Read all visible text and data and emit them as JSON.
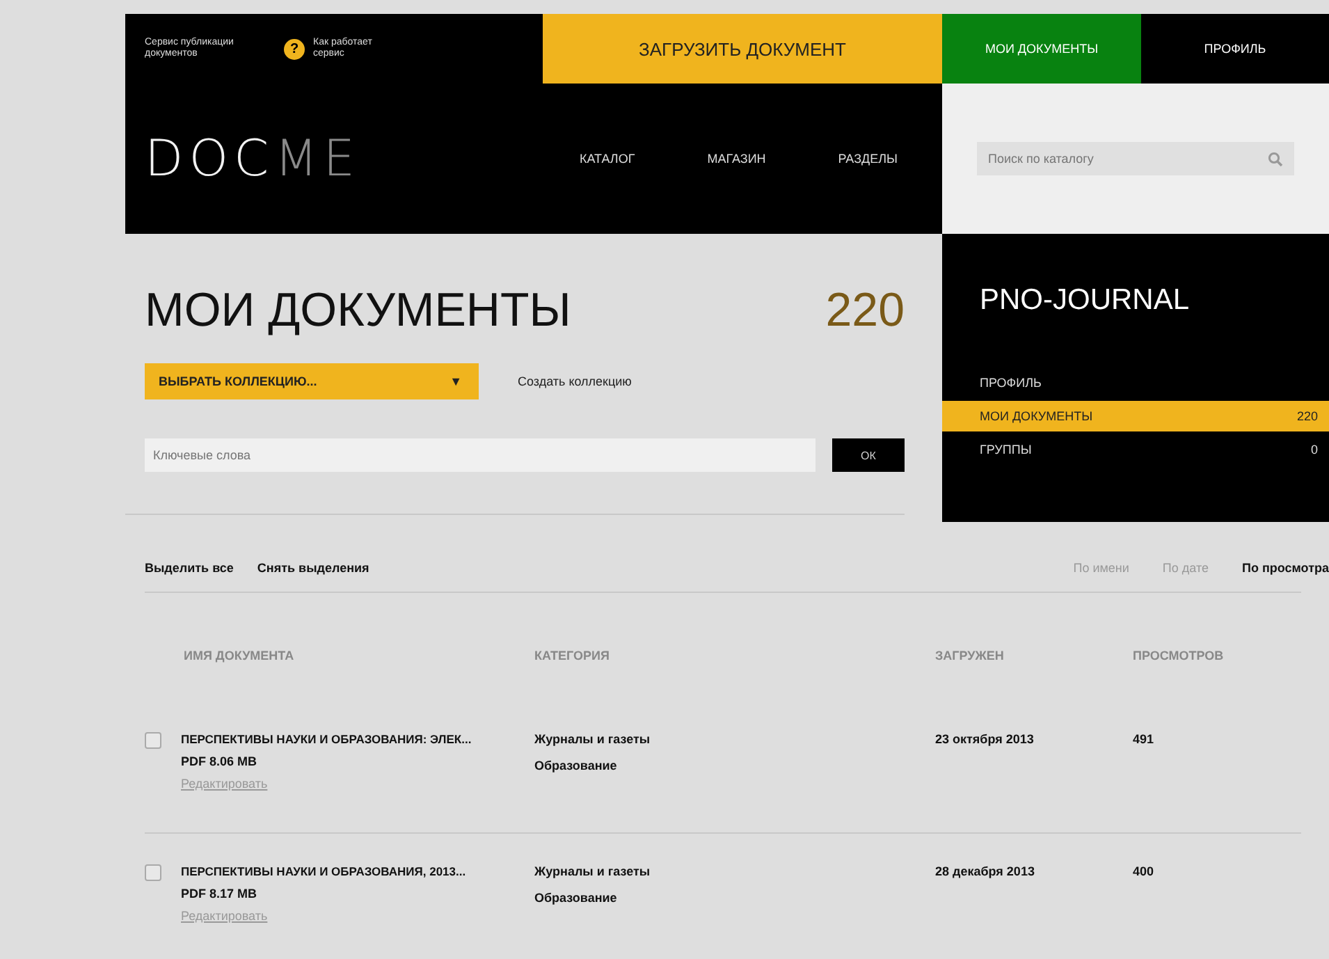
{
  "header": {
    "tagline": "Сервис публикации документов",
    "help_icon_text": "?",
    "help_link": "Как работает сервис",
    "upload_button": "ЗАГРУЗИТЬ ДОКУМЕНТ",
    "top_nav": [
      {
        "label": "МОИ ДОКУМЕНТЫ",
        "selected": true
      },
      {
        "label": "ПРОФИЛЬ",
        "selected": false
      }
    ],
    "logo": {
      "part_1": "DOC",
      "part_2": "ME"
    },
    "nav": [
      "КАТАЛОГ",
      "МАГАЗИН",
      "РАЗДЕЛЫ"
    ],
    "search": {
      "placeholder": "Поиск по каталогу"
    }
  },
  "main": {
    "title": "МОИ ДОКУМЕНТЫ",
    "count": "220",
    "collection_select": "ВЫБРАТЬ КОЛЛЕКЦИЮ...",
    "collection_caret": "▼",
    "create_collection": "Создать коллекцию",
    "keywords": {
      "placeholder": "Ключевые слова"
    },
    "ok_button": "ОК"
  },
  "sidebar": {
    "user": "PNO-JOURNAL",
    "items": [
      {
        "label": "ПРОФИЛЬ",
        "selected": false
      },
      {
        "label": "МОИ ДОКУМЕНТЫ",
        "count": "220",
        "selected": true
      },
      {
        "label": "ГРУППЫ",
        "count": "0",
        "selected": false
      }
    ]
  },
  "selection": [
    "Выделить все",
    "Снять выделения"
  ],
  "sort": [
    {
      "label": "По имени",
      "selected": false
    },
    {
      "label": "По дате",
      "selected": false
    },
    {
      "label": "По просмотра",
      "selected": true
    }
  ],
  "table": {
    "columns": [
      "ИМЯ ДОКУМЕНТА",
      "КАТЕГОРИЯ",
      "ЗАГРУЖЕН",
      "ПРОСМОТРОВ"
    ],
    "rows": [
      {
        "checked": false,
        "name": "ПЕРСПЕКТИВЫ НАУКИ И ОБРАЗОВАНИЯ: ЭЛЕК...",
        "file": "PDF  8.06 MB",
        "edit": "Редактировать",
        "categories": [
          "Журналы и газеты",
          "Образование"
        ],
        "date": "23 октября 2013",
        "views": "491"
      },
      {
        "checked": false,
        "name": "ПЕРСПЕКТИВЫ НАУКИ И ОБРАЗОВАНИЯ, 2013...",
        "file": "PDF  8.17 MB",
        "edit": "Редактировать",
        "categories": [
          "Журналы и газеты",
          "Образование"
        ],
        "date": "28 декабря 2013",
        "views": "400"
      }
    ]
  }
}
